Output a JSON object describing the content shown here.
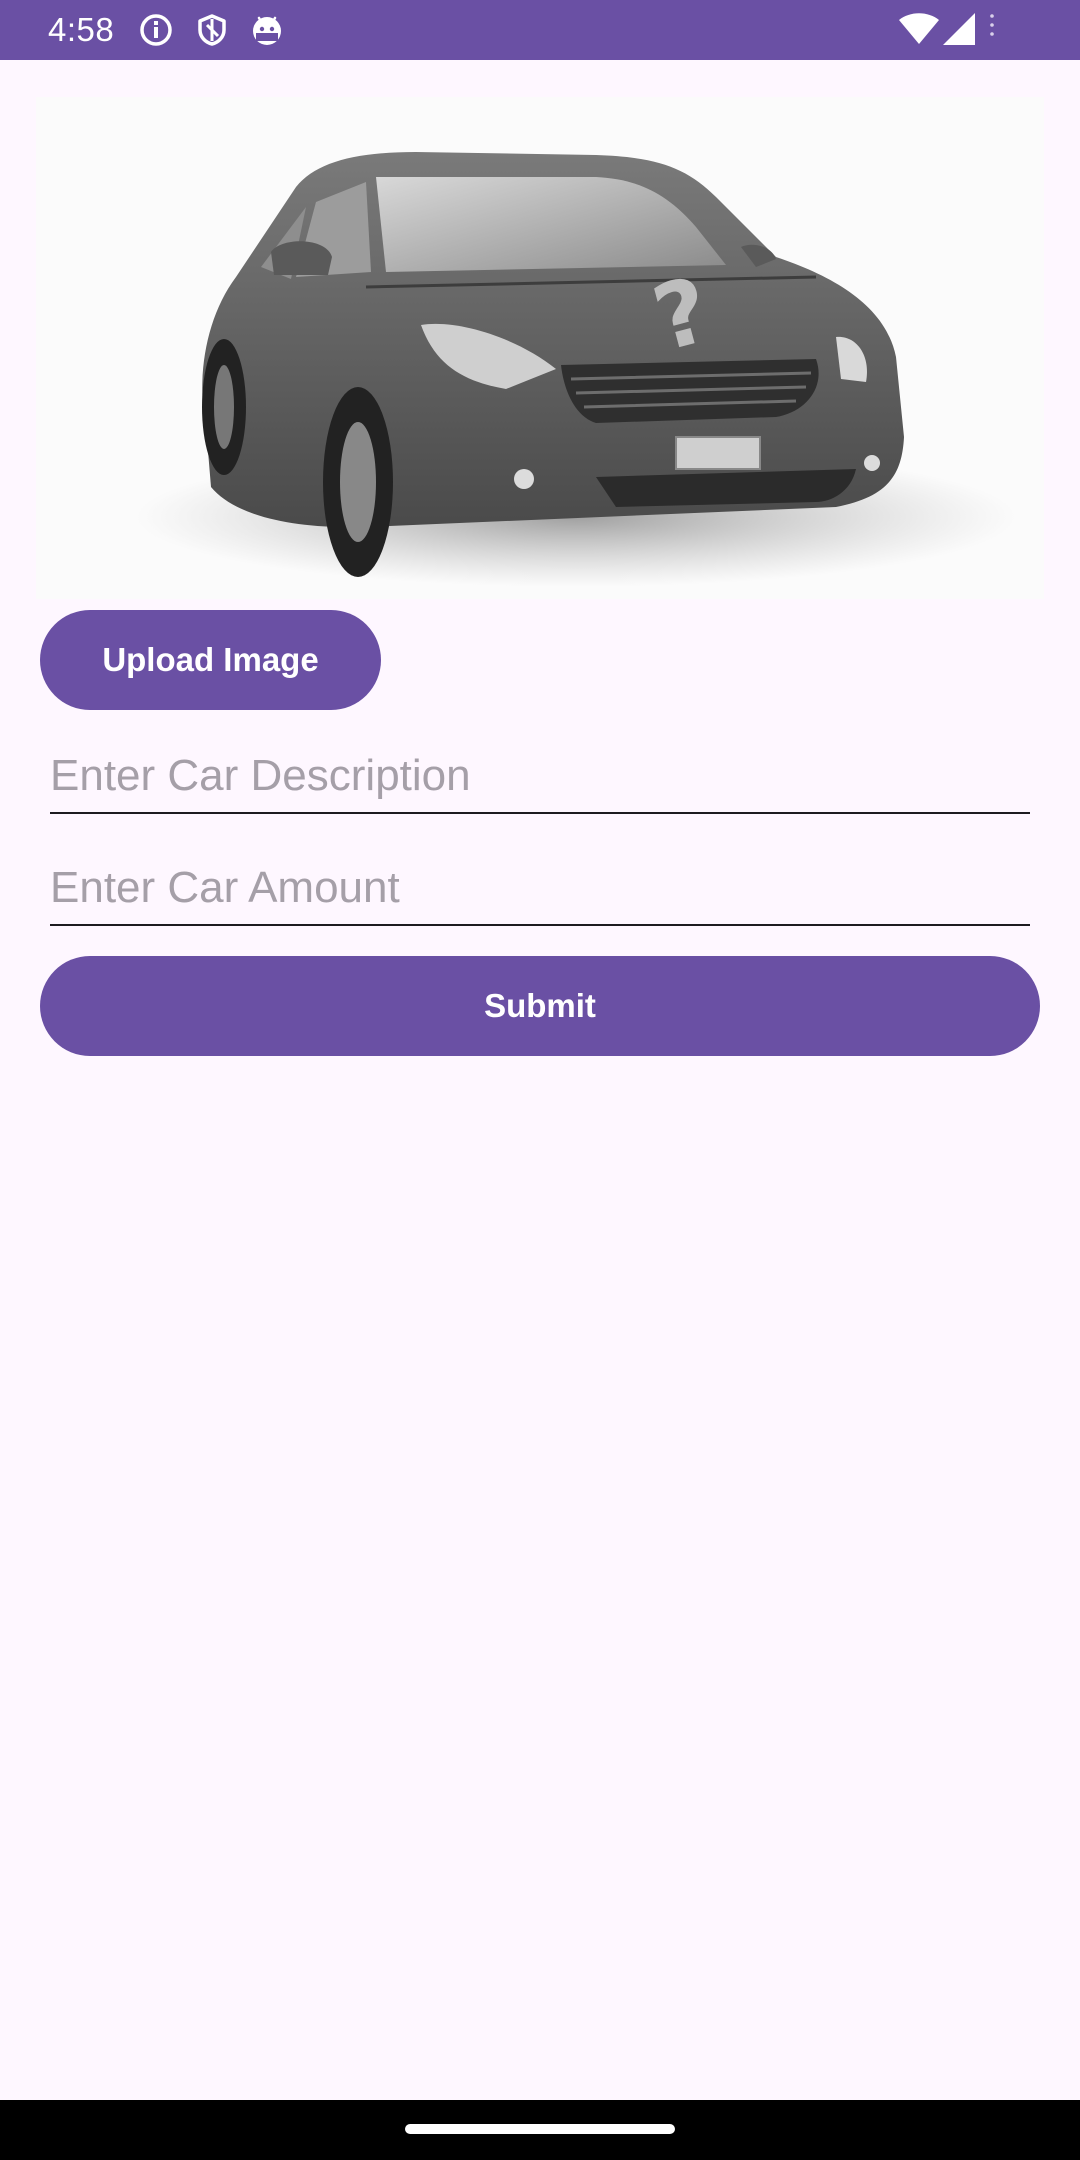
{
  "status_bar": {
    "time": "4:58",
    "background_color": "#6A50A4",
    "left_icons": [
      "info-icon",
      "shield-icon",
      "android-icon"
    ],
    "right_icons": [
      "wifi-icon",
      "cellular-signal-icon",
      "more-dots-icon"
    ]
  },
  "car_image": {
    "icon": "car-question-image"
  },
  "upload_button": {
    "label": "Upload Image"
  },
  "description_field": {
    "value": "",
    "placeholder": "Enter Car Description"
  },
  "amount_field": {
    "value": "",
    "placeholder": "Enter Car Amount"
  },
  "submit_button": {
    "label": "Submit"
  },
  "colors": {
    "accent": "#6A50A4",
    "background": "#FEF7FF",
    "placeholder": "#A59FA8"
  }
}
